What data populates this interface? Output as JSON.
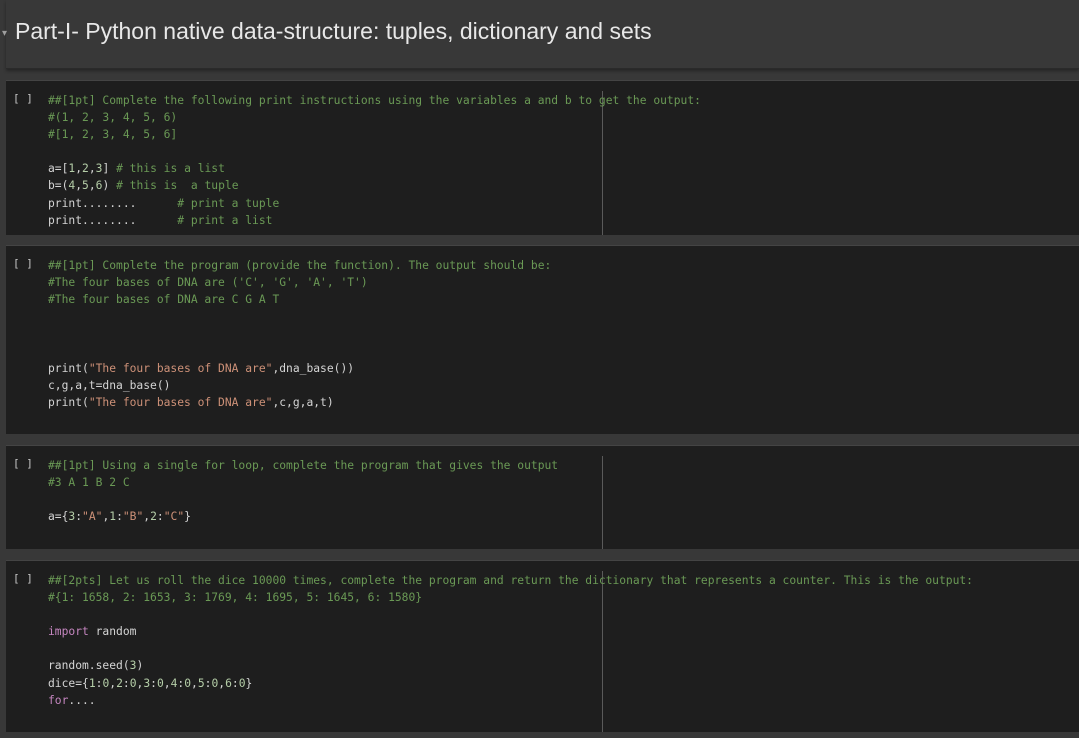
{
  "heading": {
    "title": "Part-I- Python native data-structure: tuples, dictionary and sets",
    "caret": "▾"
  },
  "run_bracket": "[ ]",
  "cells": [
    {
      "lines": [
        "##[1pt] Complete the following print instructions using the variables a and b to get the output:",
        "#(1, 2, 3, 4, 5, 6)",
        "#[1, 2, 3, 4, 5, 6]",
        "",
        "a=[1,2,3] # this is a list",
        "b=(4,5,6) # this is  a tuple",
        "print........      # print a tuple",
        "print........      # print a list"
      ]
    },
    {
      "lines": [
        "##[1pt] Complete the program (provide the function). The output should be:",
        "#The four bases of DNA are ('C', 'G', 'A', 'T')",
        "#The four bases of DNA are C G A T",
        "",
        "",
        "",
        "print(\"The four bases of DNA are\",dna_base())",
        "c,g,a,t=dna_base()",
        "print(\"The four bases of DNA are\",c,g,a,t)"
      ]
    },
    {
      "lines": [
        "##[1pt] Using a single for loop, complete the program that gives the output",
        "#3 A 1 B 2 C",
        "",
        "a={3:\"A\",1:\"B\",2:\"C\"}"
      ]
    },
    {
      "lines": [
        "##[2pts] Let us roll the dice 10000 times, complete the program and return the dictionary that represents a counter. This is the output:",
        "#{1: 1658, 2: 1653, 3: 1769, 4: 1695, 5: 1645, 6: 1580}",
        "",
        "import random",
        "",
        "random.seed(3)",
        "dice={1:0,2:0,3:0,4:0,5:0,6:0}",
        "for...."
      ]
    }
  ]
}
